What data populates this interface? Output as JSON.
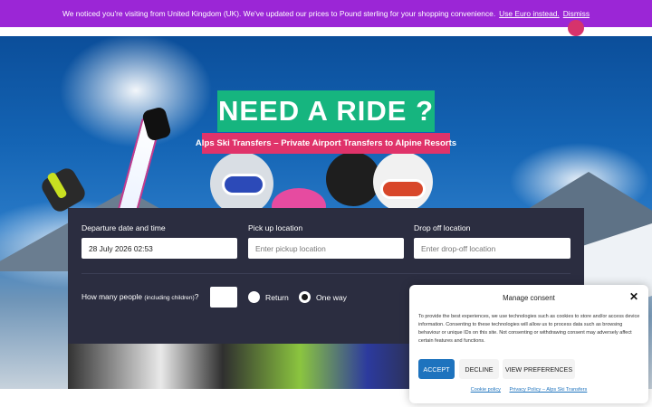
{
  "notice": {
    "message": "We noticed you're visiting from United Kingdom (UK). We've updated our prices to Pound sterling for your shopping convenience.",
    "use_euro_link": "Use Euro instead.",
    "dismiss_link": "Dismiss"
  },
  "hero": {
    "headline": "NEED A RIDE ?",
    "subheadline": "Alps Ski Transfers – Private Airport Transfers to Alpine Resorts"
  },
  "booking": {
    "departure_label": "Departure date and time",
    "departure_value": "28 July 2026 02:53",
    "pickup_label": "Pick up location",
    "pickup_placeholder": "Enter pickup location",
    "dropoff_label": "Drop off location",
    "dropoff_placeholder": "Enter drop-off location",
    "people_label": "How many people",
    "people_hint": "(including children)",
    "people_qmark": "?",
    "trip_options": [
      {
        "label": "Return",
        "selected": false
      },
      {
        "label": "One way",
        "selected": true
      }
    ]
  },
  "consent": {
    "title": "Manage consent",
    "body": "To provide the best experiences, we use technologies such as cookies to store and/or access device information. Consenting to these technologies will allow us to process data such as browsing behaviour or unique IDs on this site. Not consenting or withdrawing consent may adversely affect certain features and functions.",
    "accept": "ACCEPT",
    "decline": "DECLINE",
    "preferences": "VIEW PREFERENCES",
    "cookie_policy": "Cookie policy",
    "privacy_policy": "Privacy Policy – Alps Ski Transfers"
  },
  "colors": {
    "notice_bg": "#9b26d6",
    "headline_bg": "#16b57f",
    "subheadline_bg": "#e0336a",
    "form_bg": "#2b2d40",
    "accept_bg": "#1e73be"
  }
}
